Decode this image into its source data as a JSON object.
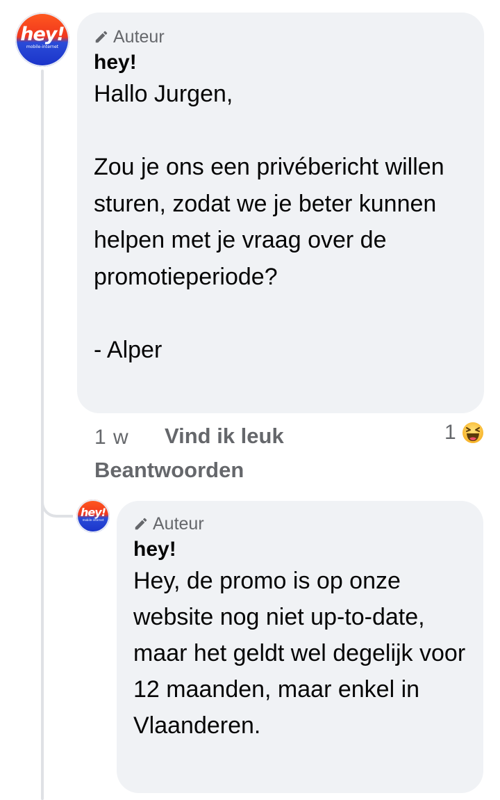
{
  "colors": {
    "bubble_background": "#f0f2f5",
    "secondary_text": "#65676b",
    "thread_line": "#dfe1e5",
    "brand_orange": "#f0361e",
    "brand_blue": "#1a33c9"
  },
  "comment": {
    "avatar": {
      "logo": "hey!",
      "logo_sub": "mobile-internet",
      "icon": "hey-logo-avatar"
    },
    "badge": {
      "icon": "pencil-icon",
      "label": "Auteur"
    },
    "author": "hey!",
    "text": "Hallo Jurgen,\n\nZou je ons een privébericht willen sturen, zodat we je beter kunnen helpen met je vraag over de promotieperiode?\n\n- Alper",
    "timestamp": "1 w",
    "like_label": "Vind ik leuk",
    "reply_label": "Beantwoorden",
    "reaction": {
      "count": "1",
      "icon": "haha-emoji-icon"
    }
  },
  "reply": {
    "avatar": {
      "logo": "hey!",
      "logo_sub": "mobile-internet",
      "icon": "hey-logo-avatar"
    },
    "badge": {
      "icon": "pencil-icon",
      "label": "Auteur"
    },
    "author": "hey!",
    "text": "Hey, de promo is op onze website nog niet up-to-date, maar het geldt wel degelijk voor 12 maanden, maar enkel in Vlaanderen."
  }
}
